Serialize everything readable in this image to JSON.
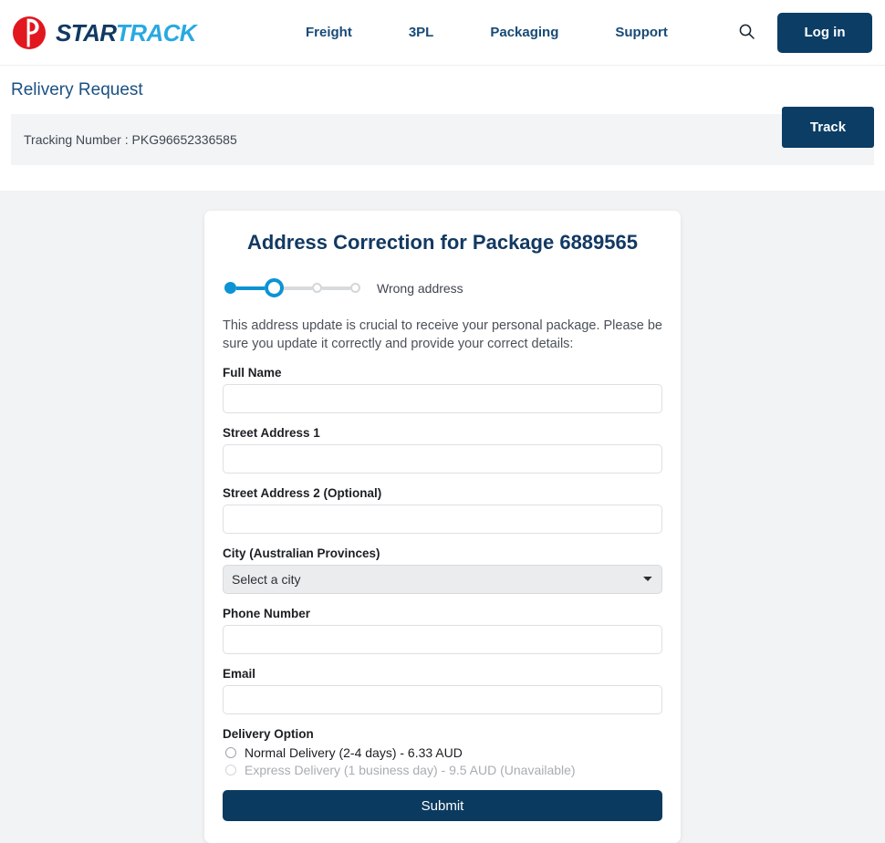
{
  "header": {
    "brand": {
      "logo_icon": "australia-post-circle-icon",
      "word_dark": "STAR",
      "word_light": "TRACK",
      "color_dark": "#123962",
      "color_light": "#29a9e1",
      "mark_color": "#e1161f"
    },
    "nav": [
      {
        "label": "Freight"
      },
      {
        "label": "3PL"
      },
      {
        "label": "Packaging"
      },
      {
        "label": "Support"
      }
    ],
    "search_icon": "search-icon",
    "login_label": "Log in",
    "accent_navy": "#0b3d65"
  },
  "subheader": {
    "page_heading": "Relivery Request",
    "tracking_label": "Tracking Number : PKG96652336585",
    "track_button": "Track"
  },
  "card": {
    "title": "Address Correction for Package 6889565",
    "stepper": {
      "label": "Wrong address",
      "active_color": "#0d93d4",
      "inactive_color": "#d8dbde",
      "steps_total": 4,
      "current_step": 2
    },
    "intro": "This address update is crucial to receive your personal package. Please be sure you update it correctly and provide your correct details:",
    "fields": [
      {
        "label": "Full Name",
        "value": "",
        "placeholder": ""
      },
      {
        "label": "Street Address 1",
        "value": "",
        "placeholder": ""
      },
      {
        "label": "Street Address 2 (Optional)",
        "value": "",
        "placeholder": ""
      },
      {
        "label": "Phone Number",
        "value": "",
        "placeholder": ""
      },
      {
        "label": "Email",
        "value": "",
        "placeholder": ""
      }
    ],
    "city_field": {
      "label": "City (Australian Provinces)",
      "selected": "Select a city",
      "chevron_icon": "chevron-down-icon"
    },
    "delivery": {
      "label": "Delivery Option",
      "options": [
        {
          "label": "Normal Delivery (2-4 days) - 6.33 AUD",
          "disabled": false,
          "selected": false
        },
        {
          "label": "Express Delivery (1 business day) - 9.5 AUD (Unavailable)",
          "disabled": true,
          "selected": false
        }
      ]
    },
    "submit_label": "Submit"
  }
}
